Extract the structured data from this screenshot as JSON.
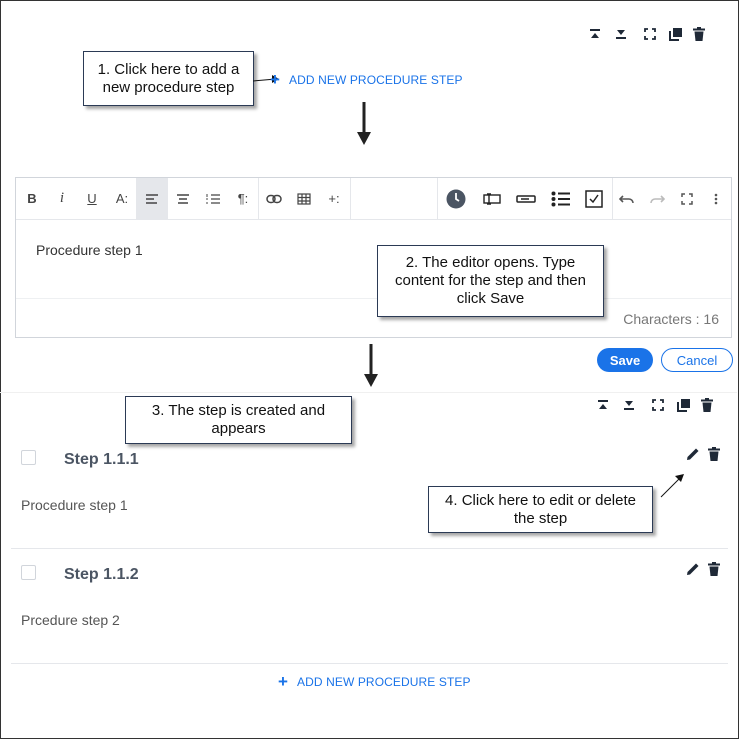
{
  "callouts": {
    "c1": "1. Click here to add a new procedure step",
    "c2": "2. The editor opens. Type content for the step and then click Save",
    "c3": "3. The step is created and appears",
    "c4": "4. Click here to edit or delete the step"
  },
  "top_toolbar_icons": [
    "collapse-all-icon",
    "expand-all-icon",
    "fullscreen-icon",
    "copy-icon",
    "delete-icon"
  ],
  "add_step_label": "ADD NEW PROCEDURE STEP",
  "editor": {
    "content": "Procedure step 1",
    "characters": "Characters : 16",
    "toolbar": [
      "B",
      "i",
      "U",
      "A:",
      "align-left",
      "align-center",
      "ordered-list",
      "¶:",
      "link",
      "table",
      "+:",
      "clock",
      "field",
      "input",
      "checklist",
      "checkbox",
      "undo",
      "redo",
      "fullscreen",
      "more"
    ]
  },
  "actions": {
    "save": "Save",
    "cancel": "Cancel"
  },
  "steps": [
    {
      "title": "Step 1.1.1",
      "body": "Procedure step 1"
    },
    {
      "title": "Step 1.1.2",
      "body": "Prcedure step 2"
    }
  ],
  "colors": {
    "accent": "#1a73e8",
    "icon": "#1f2937"
  }
}
